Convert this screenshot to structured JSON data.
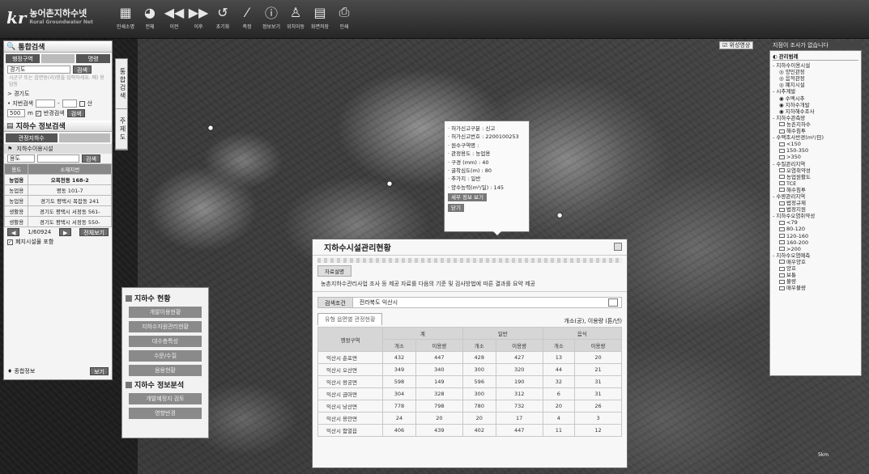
{
  "app": {
    "logo_mark": "kr",
    "logo_name": "농어촌지하수넷",
    "logo_sub": "Rural Groundwater Net"
  },
  "toolbar": [
    {
      "label": "인쇄소명",
      "icon": "map-icon",
      "glyph": "▦"
    },
    {
      "label": "전체",
      "icon": "globe-icon",
      "glyph": "◕"
    },
    {
      "label": "이전",
      "icon": "back-icon",
      "glyph": "◀◀"
    },
    {
      "label": "이후",
      "icon": "forward-icon",
      "glyph": "▶▶"
    },
    {
      "label": "초기화",
      "icon": "reset-icon",
      "glyph": "↺"
    },
    {
      "label": "측정",
      "icon": "ruler-icon",
      "glyph": "⁄"
    },
    {
      "label": "정보보기",
      "icon": "info-icon",
      "glyph": "ⓘ"
    },
    {
      "label": "위치이동",
      "icon": "person-pin-icon",
      "glyph": "♙"
    },
    {
      "label": "화면저장",
      "icon": "save-screen-icon",
      "glyph": "▤"
    },
    {
      "label": "인쇄",
      "icon": "print-icon",
      "glyph": "⎙"
    }
  ],
  "left": {
    "title": "통합검색",
    "tabs": [
      "행정구역",
      "",
      "명령"
    ],
    "region_value": "경기도",
    "search_btn": "검색",
    "hint": "시군구 또는 읍면동(리)명을 입력하세요. 예) 용담동",
    "breadcrumb": "> 경기도",
    "lot_label": "• 지번검색",
    "mountain": "산",
    "radius_value": "500",
    "radius_unit": "m",
    "radius_check": "반경검색",
    "radius_btn": "검색",
    "info_title": "지하수 정보검색",
    "subtabs": [
      "관정지하수",
      ""
    ],
    "facility_title": "지하수이용시설",
    "select_placeholder": "용도",
    "grid_btn": "검색",
    "grid_headers": [
      "용도",
      "소재지번"
    ],
    "grid_rows": [
      [
        "농업용",
        "오목천동 168-2"
      ],
      [
        "농업용",
        "평동 101-7"
      ],
      [
        "농업용",
        "경기도 평택시 목잡동 241"
      ],
      [
        "생활용",
        "경기도 평택시 서정동 561-"
      ],
      [
        "생활용",
        "경기도 평택시 서정동 550-"
      ]
    ],
    "pager": "1/60924",
    "pager_btn": "전체보기",
    "include_check": "폐지시설물 포함",
    "footer_label": "종합정보",
    "footer_btn": "보기"
  },
  "sidetabs": [
    "통합검색",
    "주제도"
  ],
  "gw": {
    "h1": "지하수 현황",
    "b1": [
      "개발이용현황",
      "지하수자원관리현황",
      "대수층특성",
      "수문/수질",
      "음용현황"
    ],
    "h2": "지하수 정보분석",
    "b2": [
      "개발예정지 검토",
      "영향반경"
    ]
  },
  "popup": {
    "lines": [
      "· 허가신고구분 : 신고",
      "· 허가신고번호 : 2200100253",
      "· 원수구역명 :",
      "· 관정용도 : 농업용",
      "· 구경 (mm) : 40",
      "· 굴착심도(m) : 80",
      "· 추가지 : 일반",
      "· 양수능력(m³/일) : 145"
    ],
    "btn1": "세부 정보 보기",
    "btn2": "닫기"
  },
  "dialog": {
    "title": "지하수시설관리현황",
    "tag": "자료설명",
    "desc": "농촌지하수관리사업 조사 등 제공 자료를 다음의 기준 및 검사방법에 따른 결과를 요약 제공",
    "search_label": "검색조건",
    "search_value": "전라북도 익산시",
    "subtab": "유형 읍면별 관정현황",
    "unit_bar": "구분별표",
    "unit": "개소(공), 이용량 (톤/년)",
    "h_region": "행정구역",
    "h_groups": [
      "계",
      "일반",
      "음식"
    ],
    "h_sub": [
      "개소",
      "이용량",
      "개소",
      "이용량",
      "개소",
      "이용량"
    ],
    "rows": [
      [
        "익산시 춘포면",
        "432",
        "447",
        "428",
        "427",
        "13",
        "20"
      ],
      [
        "익산시 오산면",
        "349",
        "340",
        "300",
        "320",
        "44",
        "21"
      ],
      [
        "익산시 왕궁면",
        "598",
        "149",
        "596",
        "190",
        "32",
        "31"
      ],
      [
        "익산시 금마면",
        "304",
        "328",
        "300",
        "312",
        "6",
        "31"
      ],
      [
        "익산시 낭산면",
        "778",
        "798",
        "780",
        "732",
        "20",
        "26"
      ],
      [
        "익산시 용안면",
        "24",
        "20",
        "20",
        "17",
        "4",
        "3"
      ],
      [
        "익산시 함열읍",
        "406",
        "439",
        "402",
        "447",
        "11",
        "12"
      ]
    ]
  },
  "right": {
    "chip": "위성영상",
    "dark": "지점이 조사가 없습니다",
    "title": "관리범례",
    "items": [
      {
        "t": "- 지하수이용시설",
        "k": "h"
      },
      {
        "t": "◎ 양민관정",
        "k": "d"
      },
      {
        "t": "◎ 음적관정",
        "k": "d"
      },
      {
        "t": "◎ 폐지시설",
        "k": "d"
      },
      {
        "t": "- 시추계발",
        "k": "h"
      },
      {
        "t": "◉ 수맥시추",
        "k": "d"
      },
      {
        "t": "◉ 지하수개발",
        "k": "d"
      },
      {
        "t": "◉ 지하해수조사",
        "k": "d"
      },
      {
        "t": "- 지하수관측망",
        "k": "h"
      },
      {
        "t": "농촌지하수",
        "k": "b"
      },
      {
        "t": "해수침투",
        "k": "b"
      },
      {
        "t": "- 수맥조사반경(m²/日)",
        "k": "h"
      },
      {
        "t": "<150",
        "k": "b"
      },
      {
        "t": "150-350",
        "k": "b"
      },
      {
        "t": ">350",
        "k": "b"
      },
      {
        "t": "- 수질관리지역",
        "k": "h"
      },
      {
        "t": "오염취약성",
        "k": "b"
      },
      {
        "t": "농업원활도",
        "k": "b"
      },
      {
        "t": "TCE",
        "k": "b"
      },
      {
        "t": "해수침투",
        "k": "b"
      },
      {
        "t": "- 수량관리지역",
        "k": "h"
      },
      {
        "t": "법정규제",
        "k": "b"
      },
      {
        "t": "법정지원",
        "k": "b"
      },
      {
        "t": "- 지하수오염취약성",
        "k": "h"
      },
      {
        "t": "<79",
        "k": "b"
      },
      {
        "t": "80-120",
        "k": "b"
      },
      {
        "t": "120-160",
        "k": "b"
      },
      {
        "t": "160-200",
        "k": "b"
      },
      {
        "t": ">200",
        "k": "b"
      },
      {
        "t": "- 지하수오염예측",
        "k": "h"
      },
      {
        "t": "매우양호",
        "k": "b"
      },
      {
        "t": "양호",
        "k": "b"
      },
      {
        "t": "보통",
        "k": "b"
      },
      {
        "t": "불량",
        "k": "b"
      },
      {
        "t": "매우불량",
        "k": "b"
      }
    ]
  },
  "map": {
    "scale": "5km"
  }
}
